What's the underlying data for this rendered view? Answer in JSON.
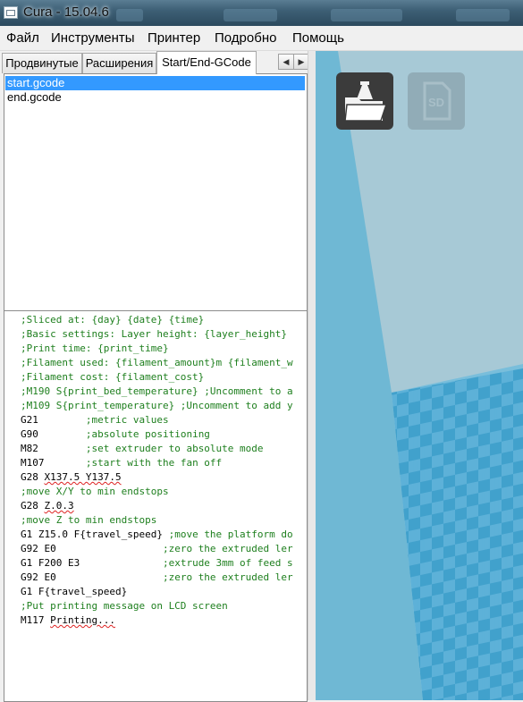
{
  "window": {
    "title": "Cura - 15.04.6"
  },
  "menu": [
    "Файл",
    "Инструменты",
    "Принтер",
    "Подробно",
    "Помощь"
  ],
  "tabs": [
    {
      "label": "Продвинутые",
      "active": false
    },
    {
      "label": "Расширения",
      "active": false
    },
    {
      "label": "Start/End-GCode",
      "active": true
    }
  ],
  "tab_scroll": {
    "left": "◀",
    "right": "▶"
  },
  "files": [
    {
      "name": "start.gcode",
      "selected": true
    },
    {
      "name": "end.gcode",
      "selected": false
    }
  ],
  "gcode": [
    {
      "pre": ";Sliced at: {day} {date} {time}",
      "comment": true
    },
    {
      "pre": ";Basic settings: Layer height: {layer_height} ",
      "comment": true
    },
    {
      "pre": ";Print time: {print_time}",
      "comment": true
    },
    {
      "pre": ";Filament used: {filament_amount}m {filament_w",
      "comment": true
    },
    {
      "pre": ";Filament cost: {filament_cost}",
      "comment": true
    },
    {
      "pre": ";M190 S{print_bed_temperature} ;Uncomment to a",
      "comment": true
    },
    {
      "pre": ";M109 S{print_temperature} ;Uncomment to add y",
      "comment": true
    },
    {
      "pre": "G21        ",
      "post": ";metric values"
    },
    {
      "pre": "G90        ",
      "post": ";absolute positioning"
    },
    {
      "pre": "M82        ",
      "post": ";set extruder to absolute mode"
    },
    {
      "pre": "M107       ",
      "post": ";start with the fan off"
    },
    {
      "pre": "G28 ",
      "wavy": "X137.5 Y137.5"
    },
    {
      "pre": ";move X/Y to min endstops",
      "comment": true
    },
    {
      "pre": "G28 ",
      "wavy": "Z.0.3"
    },
    {
      "pre": ";move Z to min endstops",
      "comment": true
    },
    {
      "pre": "G1 Z15.0 F{travel_speed} ",
      "post": ";move the platform do"
    },
    {
      "pre": "G92 E0                  ",
      "post": ";zero the extruded ler"
    },
    {
      "pre": "G1 F200 E3              ",
      "post": ";extrude 3mm of feed s"
    },
    {
      "pre": "G92 E0                  ",
      "post": ";zero the extruded ler"
    },
    {
      "pre": "G1 F{travel_speed}"
    },
    {
      "pre": ";Put printing message on LCD screen",
      "comment": true
    },
    {
      "pre": "M117 ",
      "wavy": "Printing..."
    }
  ],
  "viewport": {
    "buttons": [
      {
        "name": "load-model-button",
        "icon": "folder-load-icon",
        "enabled": true
      },
      {
        "name": "save-sd-button",
        "label": "SD",
        "icon": "sd-card-icon",
        "enabled": false
      }
    ],
    "colors": {
      "sky": "#a6cbd9",
      "platform": "#6fb8d4",
      "grid_dark": "#3e9fcb",
      "grid_light": "#5bb0d8"
    }
  }
}
